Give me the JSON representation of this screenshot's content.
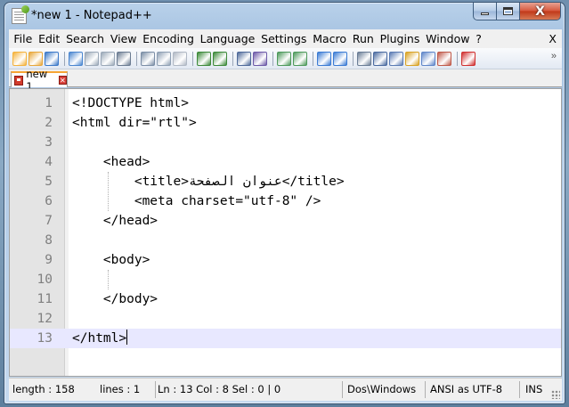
{
  "window": {
    "title": "*new  1 - Notepad++",
    "close_glyph": "X"
  },
  "menu": {
    "items": [
      "File",
      "Edit",
      "Search",
      "View",
      "Encoding",
      "Language",
      "Settings",
      "Macro",
      "Run",
      "Plugins",
      "Window",
      "?"
    ],
    "close_label": "X"
  },
  "toolbar": {
    "icons": [
      "new-file-icon",
      "open-file-icon",
      "save-icon",
      "save-all-icon",
      "close-icon",
      "close-all-icon",
      "print-icon",
      "cut-icon",
      "copy-icon",
      "paste-icon",
      "undo-icon",
      "redo-icon",
      "find-icon",
      "replace-icon",
      "zoom-in-icon",
      "zoom-out-icon",
      "sync-vertical-icon",
      "sync-horizontal-icon",
      "word-wrap-icon",
      "show-all-chars-icon",
      "indent-guide-icon",
      "user-defined-language-icon",
      "document-map-icon",
      "function-list-icon",
      "record-macro-icon"
    ],
    "overflow_glyph": "»"
  },
  "tab": {
    "label": "new 1"
  },
  "editor": {
    "lines": [
      {
        "num": "1",
        "text": "<!DOCTYPE html>"
      },
      {
        "num": "2",
        "text": "<html dir=\"rtl\">"
      },
      {
        "num": "3",
        "text": ""
      },
      {
        "num": "4",
        "text": "    <head>"
      },
      {
        "num": "5",
        "text": "        <title>عنوان الصفحة</title>"
      },
      {
        "num": "6",
        "text": "        <meta charset=\"utf-8\" />"
      },
      {
        "num": "7",
        "text": "    </head>"
      },
      {
        "num": "8",
        "text": ""
      },
      {
        "num": "9",
        "text": "    <body>"
      },
      {
        "num": "10",
        "text": ""
      },
      {
        "num": "11",
        "text": "    </body>"
      },
      {
        "num": "12",
        "text": ""
      },
      {
        "num": "13",
        "text": "</html>"
      }
    ],
    "current_line": 13
  },
  "status": {
    "length": "length : 158",
    "lines": "lines : 1",
    "position": "Ln : 13    Col : 8    Sel : 0 | 0",
    "eol": "Dos\\Windows",
    "encoding": "ANSI as UTF-8",
    "mode": "INS"
  },
  "colors": {
    "tab_accent": "#f7a635",
    "current_line": "#e8e8ff",
    "close_button": "#c13718"
  }
}
